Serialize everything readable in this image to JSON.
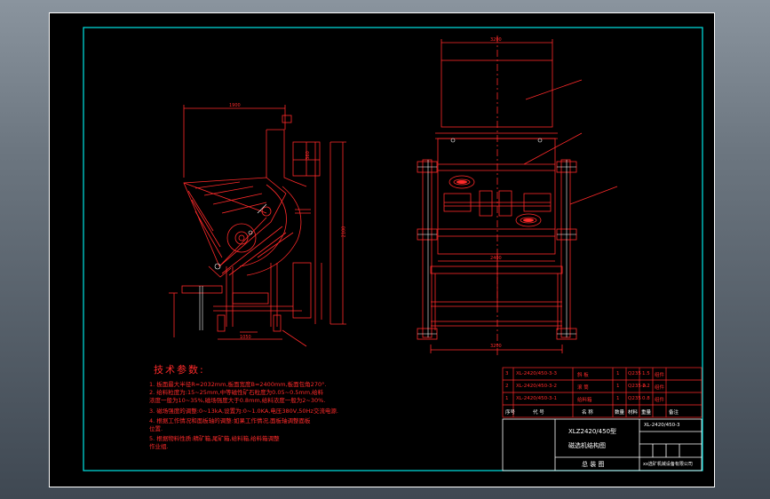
{
  "technical_requirements": {
    "title": "技术参数:",
    "notes": [
      "1. 板面最大半径R=2032mm,板面宽度B=2400mm,板面包角270°.",
      "2. 给料粒度为:15~25mm,中等磁性矿石粒度为0.05~0.5mm,给料",
      "   浓度一般为10~35%,磁场强度大于0.8mm,给料浓度一般为2~30%.",
      "3. 磁场强度的调整:0~13kA,设置为:0~1.0KA,电压380V,50Hz交流电源.",
      "4. 根据工作情况和面板轴的调整:如果工作情况,面板轴调整面板",
      "   位置.",
      "5. 根据物料性质:精矿箱,尾矿箱,给料箱,给料箱调整",
      "   作业组."
    ]
  },
  "bom": {
    "rows": [
      {
        "no": "3",
        "code": "XL-2420/450-3-3",
        "name": "斜 板",
        "qty": "1",
        "mat": "Q235",
        "wt": "1.5",
        "note": "组件"
      },
      {
        "no": "2",
        "code": "XL-2420/450-3-2",
        "name": "滚 筒",
        "qty": "1",
        "mat": "Q235-A",
        "wt": "1.2",
        "note": "组件"
      },
      {
        "no": "1",
        "code": "XL-2420/450-3-1",
        "name": "给料箱",
        "qty": "1",
        "mat": "Q235",
        "wt": "0.8",
        "note": "组件"
      }
    ],
    "header": {
      "no": "序号",
      "code": "代 号",
      "name": "名 称",
      "qty": "数量",
      "mat": "材料",
      "wt": "重量",
      "note": "备注"
    }
  },
  "title_block": {
    "model": "XLZ2420/450型",
    "name": "磁选机结构图",
    "drawing_no": "XL-2420/450-3",
    "doc_type": "总 装 图",
    "company": "xx选矿机械设备有限公司"
  },
  "dimensions": {
    "side_top": "1900",
    "side_height": "2100",
    "side_right": "360",
    "side_bottom": "1050",
    "front_top": "3200",
    "front_bottom": "3200",
    "front_mid": "2400"
  }
}
